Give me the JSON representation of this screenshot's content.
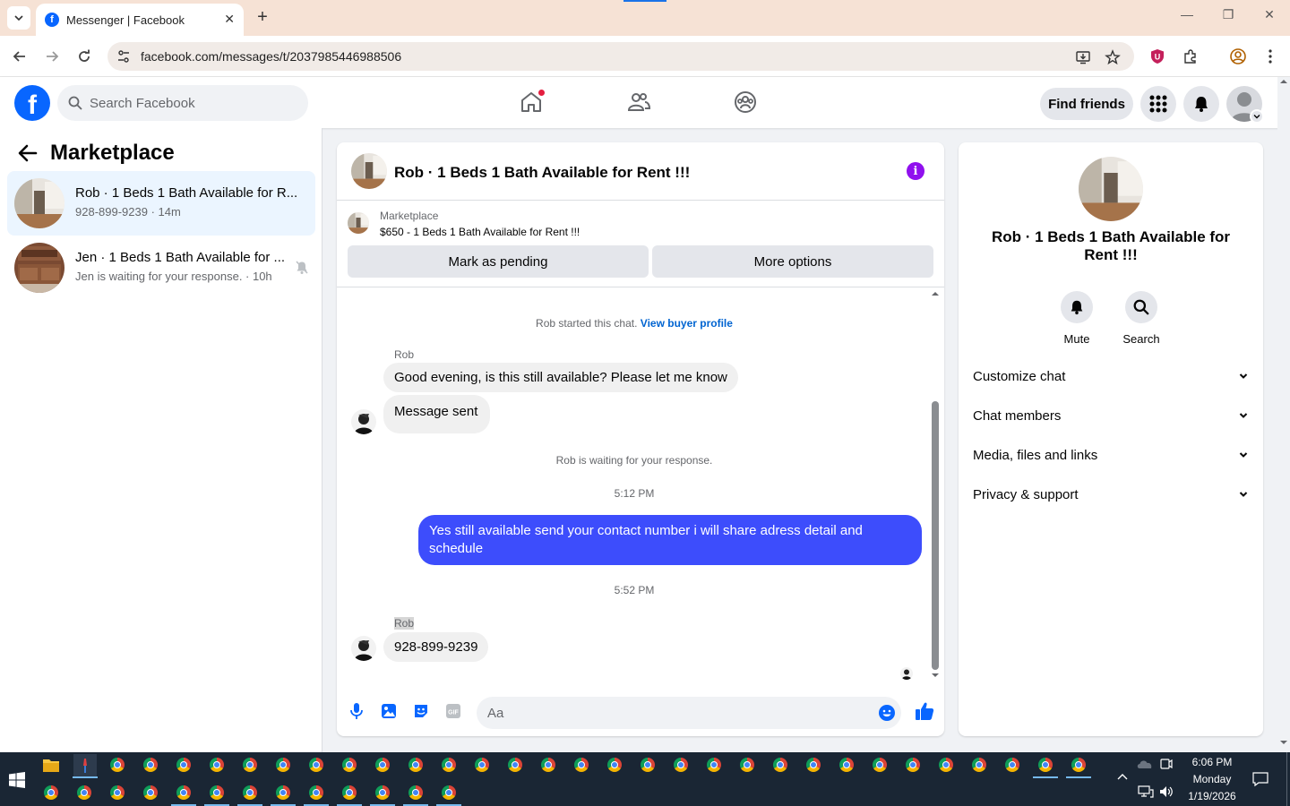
{
  "browser": {
    "tab_title": "Messenger | Facebook",
    "url": "facebook.com/messages/t/2037985446988506"
  },
  "header": {
    "search_placeholder": "Search Facebook",
    "find_friends_label": "Find friends"
  },
  "sidebar": {
    "title": "Marketplace",
    "conversations": [
      {
        "name": "Rob · 1 Beds 1 Bath Available for R...",
        "sub": "928-899-9239 · 14m",
        "active": true
      },
      {
        "name": "Jen · 1 Beds 1 Bath Available for ...",
        "sub": "Jen is waiting for your response. · 10h",
        "active": false,
        "muted": true
      }
    ]
  },
  "chat": {
    "title": "Rob · 1 Beds 1 Bath Available for Rent !!!",
    "marketplace_label": "Marketplace",
    "listing": "$650 - 1 Beds 1 Bath Available for Rent !!!",
    "mark_pending_label": "Mark as pending",
    "more_options_label": "More options",
    "started_text": "Rob started this chat.",
    "view_buyer_profile": "View buyer profile",
    "sender_1": "Rob",
    "msg_1": "Good evening, is this still available? Please let me know",
    "msg_2": "Message sent",
    "waiting_text": "Rob is waiting for your response.",
    "time_1": "5:12 PM",
    "out_msg": "Yes still available send your contact number i will share adress detail and schedule",
    "time_2": "5:52 PM",
    "sender_2": "Rob",
    "msg_3": "928-899-9239",
    "composer_placeholder": "Aa"
  },
  "details": {
    "name": "Rob · 1 Beds 1 Bath Available for Rent !!!",
    "mute_label": "Mute",
    "search_label": "Search",
    "sections": [
      "Customize chat",
      "Chat members",
      "Media, files and links",
      "Privacy & support"
    ]
  },
  "taskbar": {
    "time": "6:06 PM",
    "day": "Monday",
    "date": "1/19/2026"
  },
  "colors": {
    "facebook_blue": "#0866ff",
    "outgoing_bubble": "#3d4dfc",
    "info_purple": "#9010ee",
    "active_conversation": "#ebf5ff"
  }
}
